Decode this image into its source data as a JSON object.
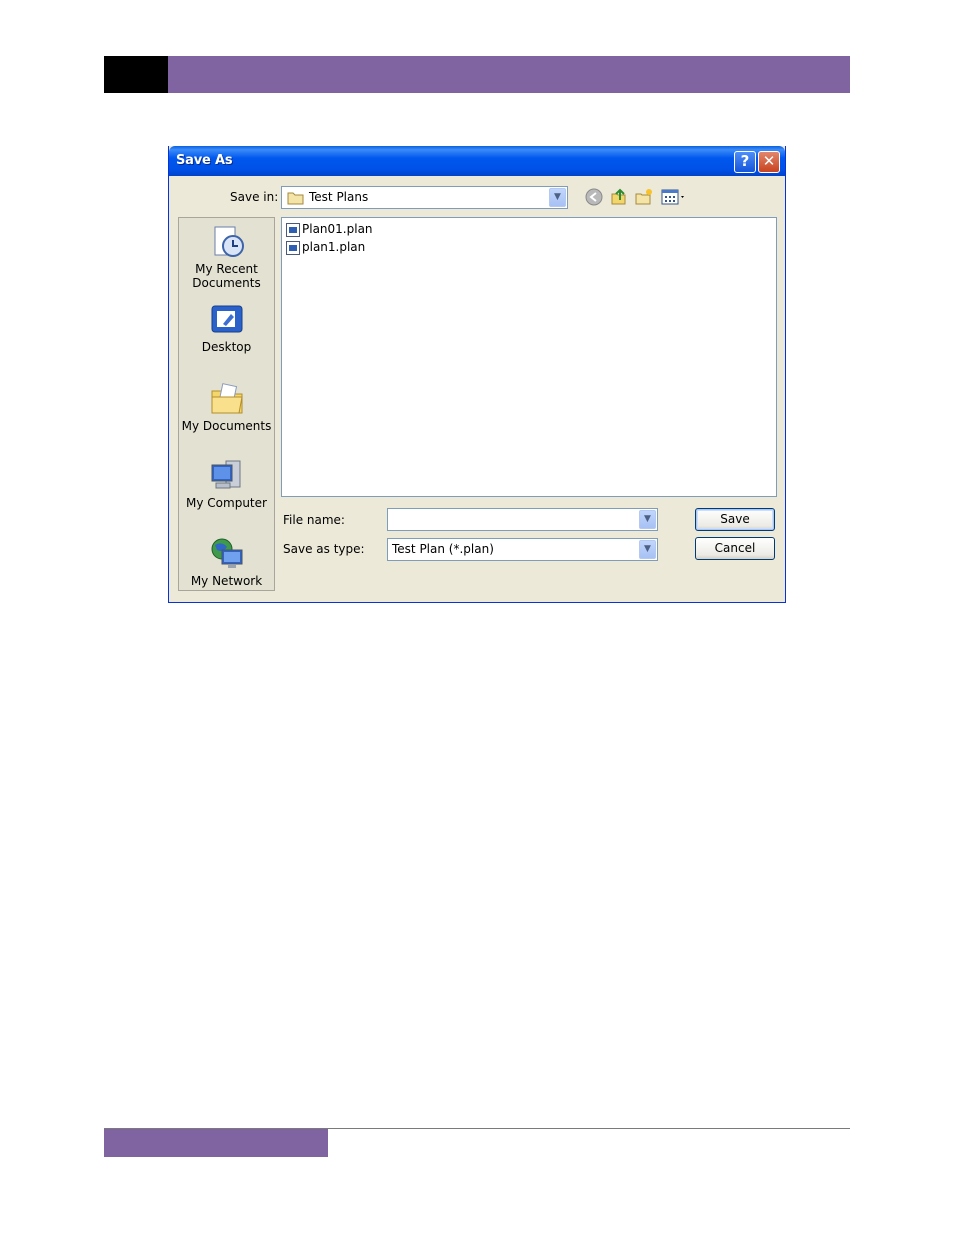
{
  "page": {
    "colors": {
      "header_purple": "#8064A2",
      "footer_purple": "#8064A2"
    }
  },
  "dialog": {
    "title": "Save As",
    "help_label": "?",
    "close_label": "✕",
    "save_in_label": "Save in:",
    "save_in_value": "Test Plans",
    "toolbar_icons": [
      "back-icon",
      "up-folder-icon",
      "new-folder-icon",
      "views-menu-icon"
    ],
    "places": [
      {
        "label": "My Recent Documents",
        "icon": "recent-documents-icon"
      },
      {
        "label": "Desktop",
        "icon": "desktop-icon"
      },
      {
        "label": "My Documents",
        "icon": "my-documents-icon"
      },
      {
        "label": "My Computer",
        "icon": "my-computer-icon"
      },
      {
        "label": "My Network",
        "icon": "my-network-icon"
      }
    ],
    "files": [
      "Plan01.plan",
      "plan1.plan"
    ],
    "file_name_label": "File name:",
    "file_name_value": "",
    "save_as_type_label": "Save as type:",
    "save_as_type_value": "Test Plan (*.plan)",
    "save_button": "Save",
    "cancel_button": "Cancel"
  }
}
